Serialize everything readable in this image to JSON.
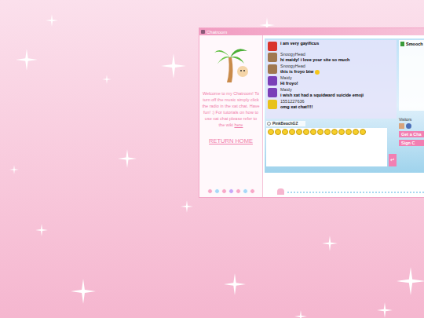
{
  "window": {
    "title": "Chatroom"
  },
  "sidebar": {
    "welcome": "Welcome to my Chatroom! To turn off the music simply click the radio in the xat chat. Have fun! :) For tutorials on how to use xat chat please refer to the wiki",
    "link": "here",
    "return_home": "RETURN HOME"
  },
  "chat": {
    "messages": [
      {
        "user": "",
        "text": "i am very gayificus",
        "color": "#d9342b"
      },
      {
        "user": "SnoogyHead",
        "text": "hi maidy! i love your site so much",
        "color": "#a07850"
      },
      {
        "user": "SnoogyHead",
        "text": "this is froyo btw",
        "color": "#a07850"
      },
      {
        "user": "Maidy",
        "text": "Hi froyo!",
        "color": "#7a3fb8"
      },
      {
        "user": "Maidy",
        "text": "i wish xat had a squidward suicide emoji",
        "color": "#7a3fb8"
      },
      {
        "user": "1551227636",
        "text": "omg xat chat!!!!",
        "color": "#e8c21a"
      }
    ],
    "current_user": "PinkBeachGZ",
    "users": [
      {
        "name": "Smooch",
        "color": "#3a9a3a"
      }
    ],
    "visitors_label": "Visitors",
    "buttons": [
      "Get a Cha",
      "Sign C"
    ],
    "send": "↵"
  }
}
